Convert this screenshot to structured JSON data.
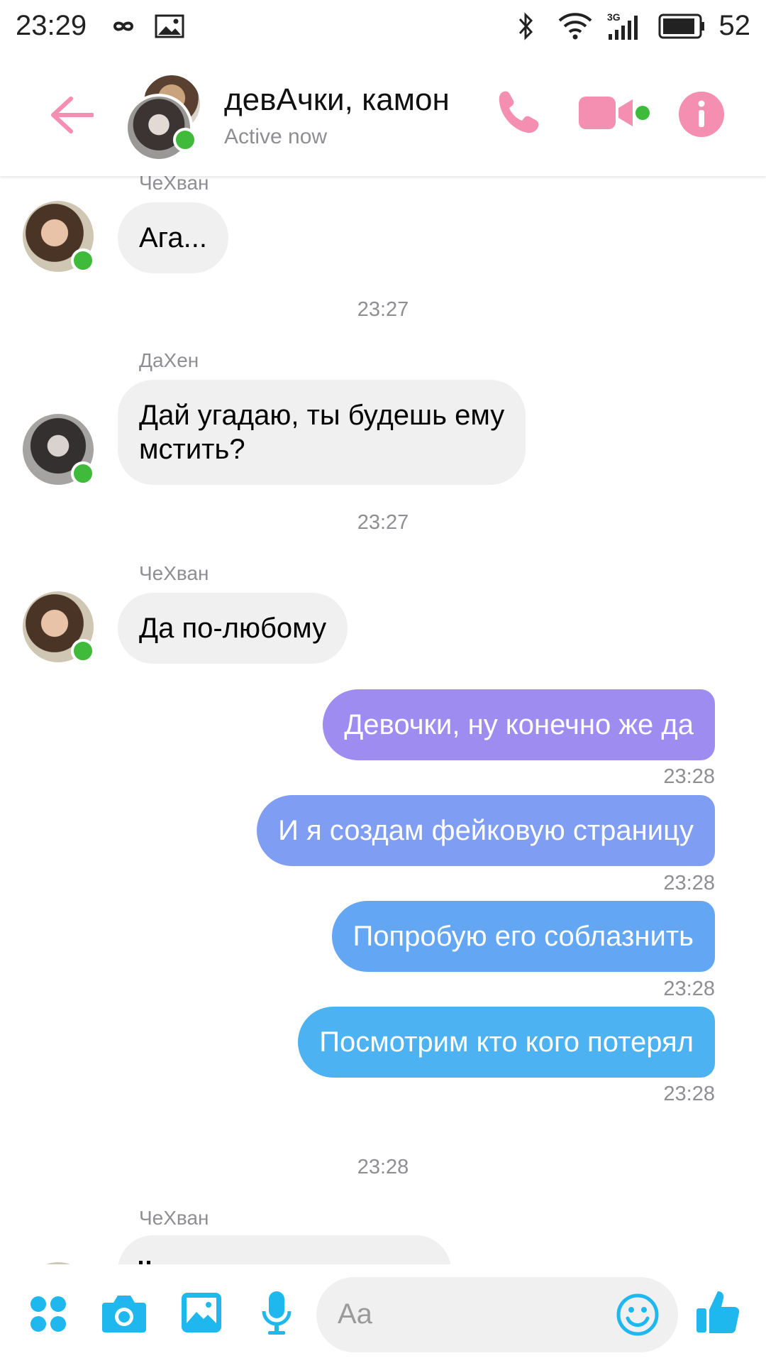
{
  "status_bar": {
    "time": "23:29",
    "network": "3G",
    "battery": "52"
  },
  "header": {
    "title": "девАчки, камон",
    "subtitle": "Active now"
  },
  "messages": {
    "m1": {
      "sender": "ЧеХван",
      "text": "Ага..."
    },
    "ts1": "23:27",
    "m2": {
      "sender": "ДаХен",
      "line1": "Дай угадаю, ты будешь ему",
      "line2": "мстить?"
    },
    "ts2": "23:27",
    "m3": {
      "sender": "ЧеХван",
      "text": "Да по-любому"
    },
    "o1": {
      "text": "Девочки, ну конечно же да",
      "time": "23:28"
    },
    "o2": {
      "text": "И я создам фейковую страницу",
      "time": "23:28"
    },
    "o3": {
      "text": "Попробую его соблазнить",
      "time": "23:28"
    },
    "o4": {
      "text": "Посмотрим кто кого потерял",
      "time": "23:28"
    },
    "ts3": "23:28",
    "m4": {
      "sender": "ЧеХван"
    }
  },
  "composer": {
    "placeholder": "Aa"
  },
  "colors": {
    "accent_pink": "#f48fb1",
    "online_green": "#3fba3a",
    "out_bubble_1": "#9f8cf1",
    "out_bubble_2": "#7e9df3",
    "out_bubble_3": "#63a7f4",
    "out_bubble_4": "#4cb2f2",
    "composer_icons": "#1fb8ee"
  }
}
